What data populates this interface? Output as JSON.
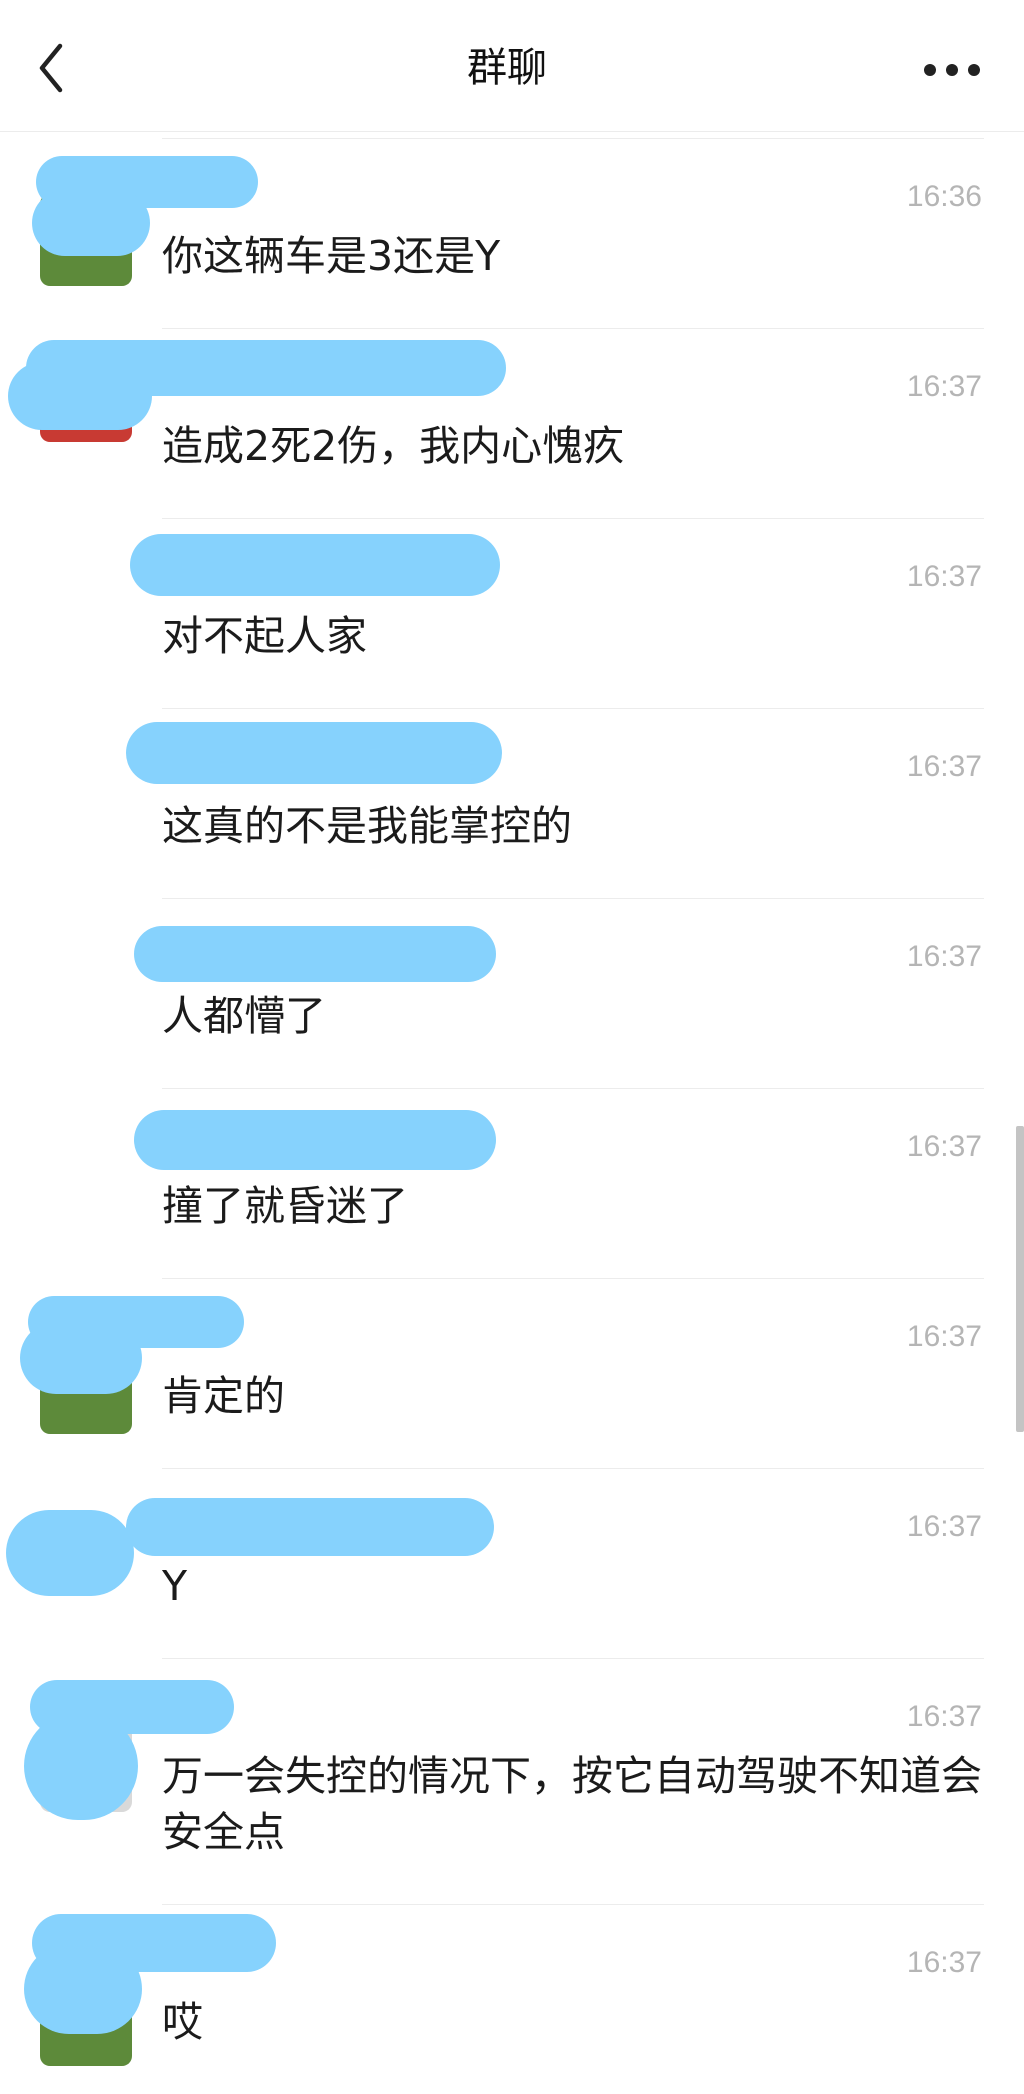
{
  "header": {
    "title": "群聊",
    "back_icon": "chevron-left-icon",
    "more_icon": "more-dots-icon"
  },
  "messages": [
    {
      "time": "16:36",
      "text": "你这辆车是3还是Y"
    },
    {
      "time": "16:37",
      "text": "造成2死2伤，我内心愧疚"
    },
    {
      "time": "16:37",
      "text": "对不起人家"
    },
    {
      "time": "16:37",
      "text": "这真的不是我能掌控的"
    },
    {
      "time": "16:37",
      "text": "人都懵了"
    },
    {
      "time": "16:37",
      "text": "撞了就昏迷了"
    },
    {
      "time": "16:37",
      "text": "肯定的"
    },
    {
      "time": "16:37",
      "text": "Y"
    },
    {
      "time": "16:37",
      "text": "万一会失控的情况下，按它自动驾驶不知道会安全点"
    },
    {
      "time": "16:37",
      "text": "哎"
    }
  ],
  "colors": {
    "redaction": "#86d2fd",
    "timestamp": "#b5b5b5",
    "divider": "#ececec"
  }
}
